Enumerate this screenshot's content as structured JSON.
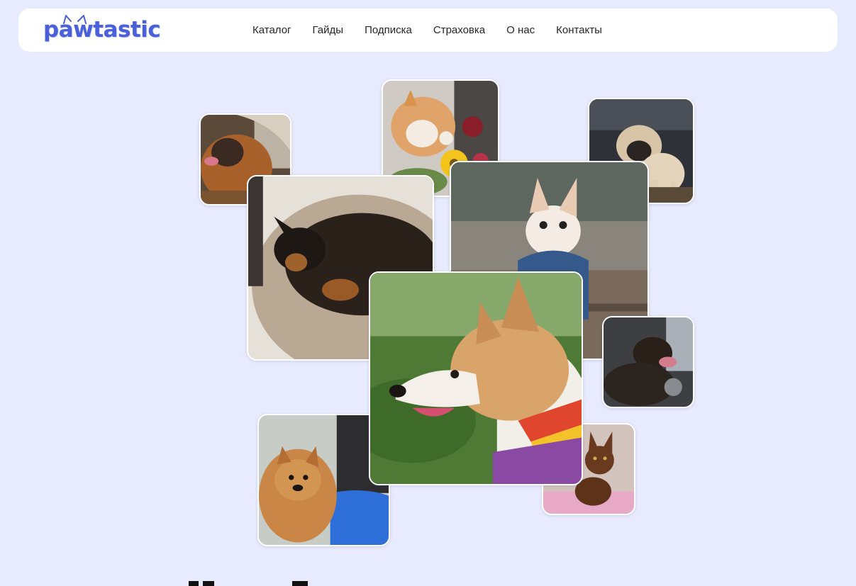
{
  "header": {
    "logo_text": "pawtastic",
    "nav": [
      "Каталог",
      "Гайды",
      "Подписка",
      "Страховка",
      "О нас",
      "Контакты"
    ]
  },
  "colors": {
    "background": "#E8EBFD",
    "header_bg": "#FFFFFF",
    "brand": "#4A5FD8",
    "nav_text": "#262626"
  },
  "gallery": {
    "photos": [
      {
        "name": "photo-pug-brown",
        "subject": "dog"
      },
      {
        "name": "photo-ginger-cat-flowers",
        "subject": "cat"
      },
      {
        "name": "photo-pug-fawn",
        "subject": "dog"
      },
      {
        "name": "photo-pinscher-bed",
        "subject": "dog"
      },
      {
        "name": "photo-chihuahua",
        "subject": "dog"
      },
      {
        "name": "photo-dachshund-car",
        "subject": "dog"
      },
      {
        "name": "photo-brown-cat",
        "subject": "cat"
      },
      {
        "name": "photo-pomeranian",
        "subject": "dog"
      },
      {
        "name": "photo-corgi",
        "subject": "dog"
      }
    ]
  }
}
